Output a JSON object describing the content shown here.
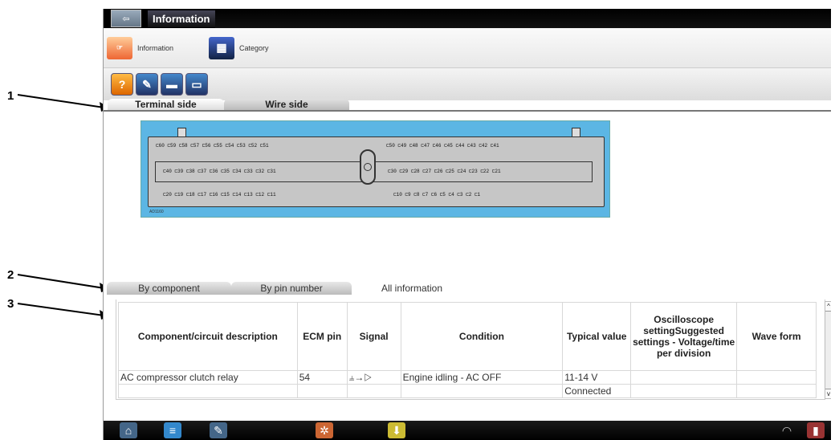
{
  "window": {
    "title": "Information"
  },
  "nav": {
    "information_label": "Information",
    "category_label": "Category"
  },
  "tabs_view": [
    "Terminal side",
    "Wire side"
  ],
  "connector": {
    "row1_left": "⊏60 ⊏59 ⊏58 ⊏57 ⊏56 ⊏55 ⊏54 ⊏53 ⊏52 ⊏51",
    "row1_right": "⊏50 ⊏49 ⊏48 ⊏47 ⊏46 ⊏45 ⊏44 ⊏43 ⊏42 ⊏41",
    "row2_left": "⊏40 ⊏39 ⊏38 ⊏37 ⊏36 ⊏35 ⊏34 ⊏33 ⊏32 ⊏31",
    "row2_right": "⊏30 ⊏29 ⊏28 ⊏27 ⊏26 ⊏25 ⊏24 ⊏23 ⊏22 ⊏21",
    "row3_left": "⊏20 ⊏19 ⊏18 ⊏17 ⊏16 ⊏15 ⊏14 ⊏13 ⊏12 ⊏11",
    "row3_right": "⊏10 ⊏9 ⊏8 ⊏7 ⊏6 ⊏5 ⊏4 ⊏3 ⊏2 ⊏1",
    "label": "AD1160"
  },
  "tabs_table": [
    "By component",
    "By pin number",
    "All information"
  ],
  "table": {
    "headers": [
      "Component/circuit description",
      "ECM pin",
      "Signal",
      "Condition",
      "Typical value",
      "Oscilloscope settingSuggested settings - Voltage/time per division",
      "Wave form"
    ],
    "rows": [
      [
        "AC compressor clutch relay",
        "54",
        "⫨→▷",
        "Engine idling - AC OFF",
        "11-14 V",
        "",
        ""
      ],
      [
        "",
        "",
        "",
        "",
        "Connected",
        "",
        ""
      ]
    ]
  },
  "callouts": [
    "1",
    "2",
    "3"
  ],
  "colors": {
    "connector_bg": "#5cb6e4",
    "titlebar": "#000000"
  },
  "icons": [
    "help-icon",
    "book-icon",
    "folder-icon",
    "folder-open-icon",
    "home-icon",
    "list-icon",
    "wrench-icon",
    "tools-icon",
    "download-icon",
    "wifi-icon",
    "battery-icon"
  ]
}
